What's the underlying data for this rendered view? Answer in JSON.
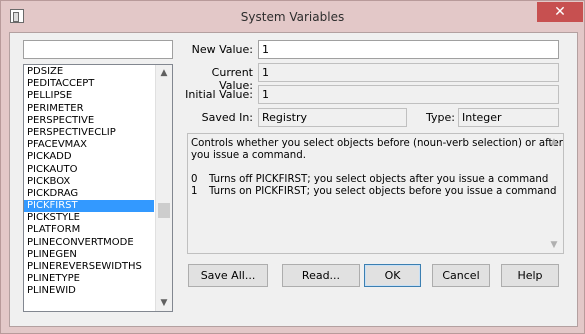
{
  "window": {
    "title": "System Variables",
    "close_glyph": "✕"
  },
  "search": {
    "value": ""
  },
  "variable_list": {
    "items": [
      "PDSIZE",
      "PEDITACCEPT",
      "PELLIPSE",
      "PERIMETER",
      "PERSPECTIVE",
      "PERSPECTIVECLIP",
      "PFACEVMAX",
      "PICKADD",
      "PICKAUTO",
      "PICKBOX",
      "PICKDRAG",
      "PICKFIRST",
      "PICKSTYLE",
      "PLATFORM",
      "PLINECONVERTMODE",
      "PLINEGEN",
      "PLINEREVERSEWIDTHS",
      "PLINETYPE",
      "PLINEWID"
    ],
    "selected": "PICKFIRST"
  },
  "fields": {
    "new_value_label": "New Value:",
    "new_value": "1",
    "current_value_label": "Current Value:",
    "current_value": "1",
    "initial_value_label": "Initial Value:",
    "initial_value": "1",
    "saved_in_label": "Saved In:",
    "saved_in": "Registry",
    "type_label": "Type:",
    "type": "Integer"
  },
  "description": {
    "line1": "Controls whether you select objects before (noun-verb selection) or after",
    "line2": "you issue a command.",
    "options": [
      {
        "code": "0",
        "text": "Turns off PICKFIRST; you select objects after you issue a command"
      },
      {
        "code": "1",
        "text": "Turns on PICKFIRST; you select objects before you issue a command"
      }
    ]
  },
  "buttons": {
    "save_all": "Save All...",
    "read": "Read...",
    "ok": "OK",
    "cancel": "Cancel",
    "help": "Help"
  }
}
